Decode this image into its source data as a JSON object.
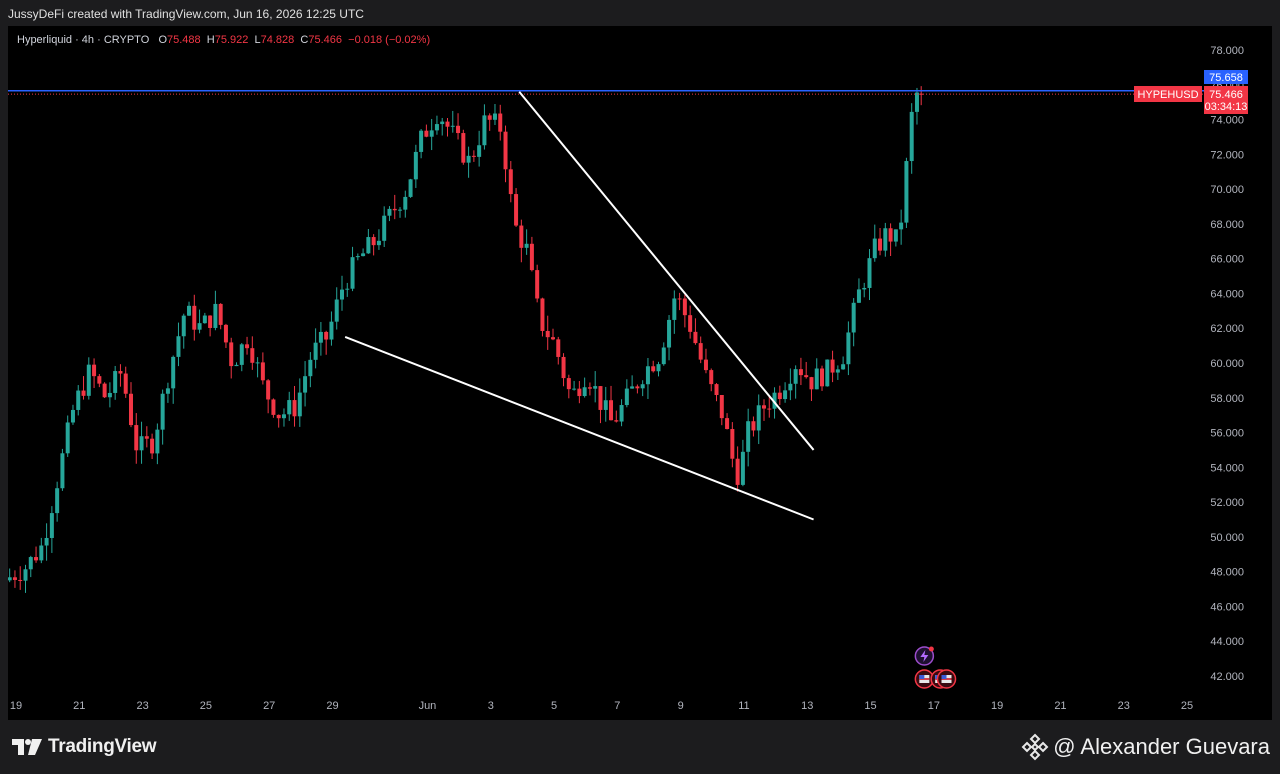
{
  "caption": "JussyDeFi created with TradingView.com, Jun 16, 2026 12:25 UTC",
  "legend": {
    "symbol": "Hyperliquid · 4h · CRYPTO",
    "o_label": "O",
    "o_value": "75.488",
    "h_label": "H",
    "h_value": "75.922",
    "l_label": "L",
    "l_value": "74.828",
    "c_label": "C",
    "c_value": "75.466",
    "change": "−0.018 (−0.02%)"
  },
  "price_tags": {
    "line_price": "75.658",
    "symbol_tag": "HYPEHUSD",
    "last_price": "75.466",
    "countdown": "03:34:13"
  },
  "footer": {
    "brand": "TradingView",
    "author": "@ Alexander Guevara"
  },
  "icons": [
    "tv-logo-icon",
    "binance-diamond-icon",
    "lightning-event-icon",
    "us-flag-event-icon"
  ],
  "colors": {
    "up": "#26a69a",
    "down": "#f23645",
    "hline": "#2962ff",
    "trendline": "#ffffff",
    "price_tag_blue": "#2962ff",
    "price_tag_red": "#f23645"
  },
  "chart_data": {
    "type": "candlestick",
    "timeframe": "4h",
    "ylim": [
      41,
      80
    ],
    "yticks": [
      "42.000",
      "44.000",
      "46.000",
      "48.000",
      "50.000",
      "52.000",
      "54.000",
      "56.000",
      "58.000",
      "60.000",
      "62.000",
      "64.000",
      "66.000",
      "68.000",
      "70.000",
      "72.000",
      "74.000",
      "76.000",
      "78.000"
    ],
    "xticks": [
      {
        "label": "19",
        "day": 19
      },
      {
        "label": "21",
        "day": 21
      },
      {
        "label": "23",
        "day": 23
      },
      {
        "label": "25",
        "day": 25
      },
      {
        "label": "27",
        "day": 27
      },
      {
        "label": "29",
        "day": 29
      },
      {
        "label": "Jun",
        "day": 32
      },
      {
        "label": "3",
        "day": 34
      },
      {
        "label": "5",
        "day": 36
      },
      {
        "label": "7",
        "day": 38
      },
      {
        "label": "9",
        "day": 40
      },
      {
        "label": "11",
        "day": 42
      },
      {
        "label": "13",
        "day": 44
      },
      {
        "label": "15",
        "day": 46
      },
      {
        "label": "17",
        "day": 48
      },
      {
        "label": "19",
        "day": 50
      },
      {
        "label": "21",
        "day": 52
      },
      {
        "label": "23",
        "day": 54
      },
      {
        "label": "25",
        "day": 56
      }
    ],
    "day_axis_note_hidden": "",
    "close_path": [
      [
        18.8,
        47.5
      ],
      [
        19.5,
        48.3
      ],
      [
        20.0,
        49.5
      ],
      [
        20.5,
        53.5
      ],
      [
        21.0,
        57.5
      ],
      [
        21.5,
        59.5
      ],
      [
        22.0,
        58.0
      ],
      [
        22.5,
        59.5
      ],
      [
        23.0,
        55.0
      ],
      [
        23.5,
        55.5
      ],
      [
        24.0,
        59.5
      ],
      [
        24.5,
        63.0
      ],
      [
        25.0,
        62.0
      ],
      [
        25.5,
        63.0
      ],
      [
        26.0,
        60.0
      ],
      [
        26.5,
        61.5
      ],
      [
        27.0,
        58.5
      ],
      [
        27.5,
        57.0
      ],
      [
        28.0,
        57.5
      ],
      [
        28.5,
        60.5
      ],
      [
        29.0,
        61.5
      ],
      [
        29.5,
        64.5
      ],
      [
        30.0,
        66.0
      ],
      [
        30.5,
        67.0
      ],
      [
        31.0,
        68.5
      ],
      [
        31.5,
        70.0
      ],
      [
        32.0,
        73.0
      ],
      [
        32.5,
        74.5
      ],
      [
        33.0,
        73.0
      ],
      [
        33.5,
        71.5
      ],
      [
        34.0,
        74.0
      ],
      [
        34.5,
        73.5
      ],
      [
        34.9,
        68.0
      ],
      [
        35.3,
        66.5
      ],
      [
        35.7,
        62.5
      ],
      [
        36.2,
        61.0
      ],
      [
        36.7,
        58.0
      ],
      [
        37.2,
        59.5
      ],
      [
        37.7,
        57.5
      ],
      [
        38.0,
        56.5
      ],
      [
        38.5,
        58.0
      ],
      [
        39.0,
        59.5
      ],
      [
        39.5,
        60.5
      ],
      [
        40.0,
        64.0
      ],
      [
        40.5,
        62.0
      ],
      [
        41.0,
        59.0
      ],
      [
        41.5,
        57.0
      ],
      [
        41.8,
        54.5
      ],
      [
        42.0,
        53.5
      ],
      [
        42.3,
        56.0
      ],
      [
        42.8,
        57.5
      ],
      [
        43.3,
        58.5
      ],
      [
        43.8,
        60.0
      ],
      [
        44.3,
        59.0
      ],
      [
        44.8,
        59.5
      ],
      [
        45.3,
        60.5
      ],
      [
        45.8,
        64.0
      ],
      [
        46.3,
        66.5
      ],
      [
        46.7,
        67.5
      ],
      [
        47.0,
        67.0
      ],
      [
        47.2,
        69.0
      ],
      [
        47.4,
        73.5
      ],
      [
        47.6,
        75.466
      ]
    ],
    "last_candle": {
      "open": 75.488,
      "high": 75.922,
      "low": 74.828,
      "close": 75.466
    },
    "horizontal_line": 75.658,
    "trendlines": [
      {
        "name": "upper-falling-trendline",
        "from": [
          34.9,
          75.6
        ],
        "to": [
          44.2,
          55.0
        ]
      },
      {
        "name": "lower-falling-trendline",
        "from": [
          29.4,
          61.5
        ],
        "to": [
          44.2,
          51.0
        ]
      }
    ],
    "event_markers": [
      {
        "type": "lightning-event-icon",
        "day": 47.7
      },
      {
        "type": "us-flag-event-icon",
        "day": 47.7
      },
      {
        "type": "us-flag-event-icon",
        "day": 48.2
      },
      {
        "type": "us-flag-event-icon",
        "day": 48.4
      }
    ]
  }
}
